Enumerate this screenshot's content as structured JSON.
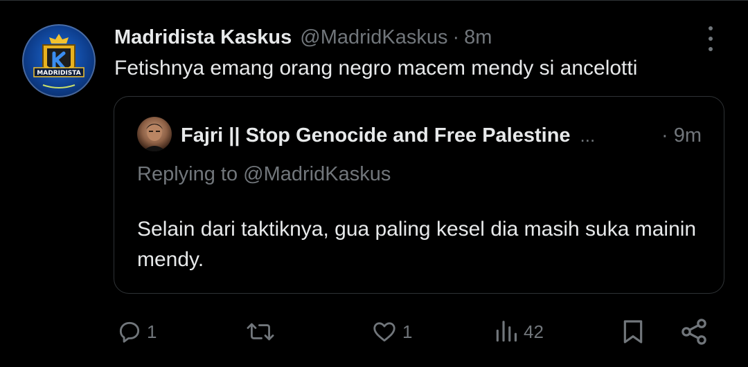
{
  "tweet": {
    "display_name": "Madridista Kaskus",
    "handle": "@MadridKaskus",
    "separator": "·",
    "time": "8m",
    "text": "Fetishnya emang orang negro macem mendy si ancelotti",
    "avatar_logo_text": "MADRIDISTA"
  },
  "quoted": {
    "display_name": "Fajri || Stop Genocide and Free Palestine",
    "ellipsis": "...",
    "time": "· 9m",
    "replying_to": "Replying to @MadridKaskus",
    "text": "Selain dari taktiknya, gua paling kesel dia masih suka mainin mendy."
  },
  "actions": {
    "replies": "1",
    "retweets": "",
    "likes": "1",
    "views": "42"
  },
  "icons": [
    "more-icon",
    "reply-icon",
    "retweet-icon",
    "like-icon",
    "views-icon",
    "bookmark-icon",
    "share-icon"
  ],
  "colors": {
    "background": "#000000",
    "text": "#e7e9ea",
    "muted": "#71767b",
    "border": "#2f3336"
  }
}
